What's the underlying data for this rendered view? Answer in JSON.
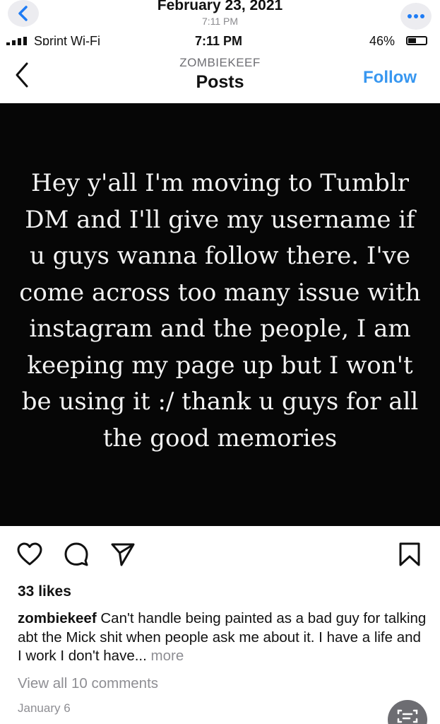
{
  "outer_header": {
    "date": "February 23, 2021",
    "time": "7:11 PM"
  },
  "status_bar": {
    "carrier": "Sprint Wi-Fi",
    "time": "7:11 PM",
    "battery_percent": "46%",
    "battery_level": 0.46
  },
  "ig_header": {
    "username": "ZOMBIEKEEF",
    "title": "Posts",
    "follow_label": "Follow"
  },
  "post": {
    "image_text": "Hey y'all I'm moving to Tumblr DM and I'll give my username if u guys wanna follow there. I've come across too many issue with instagram and the people, I am keeping my page up but I won't be using it :/ thank u guys for all the good memories",
    "likes": "33 likes",
    "caption_user": "zombiekeef",
    "caption_text": "Can't handle being painted as a bad guy for talking abt the Mick shit when people ask me about it. I have a life and I work I don't have...",
    "caption_more": "more",
    "view_comments": "View all 10 comments",
    "date": "January 6"
  },
  "colors": {
    "follow": "#3897f0",
    "ios_blue": "#1f7cf5",
    "muted": "#8e8e93",
    "post_bg": "#060606"
  },
  "icons": {
    "outer_back": "chevron-left-icon",
    "outer_more": "more-dots-icon",
    "ig_back": "chevron-left-icon",
    "like": "heart-icon",
    "comment": "comment-bubble-icon",
    "share": "paper-plane-icon",
    "save": "bookmark-icon",
    "floating": "text-recognition-icon"
  }
}
